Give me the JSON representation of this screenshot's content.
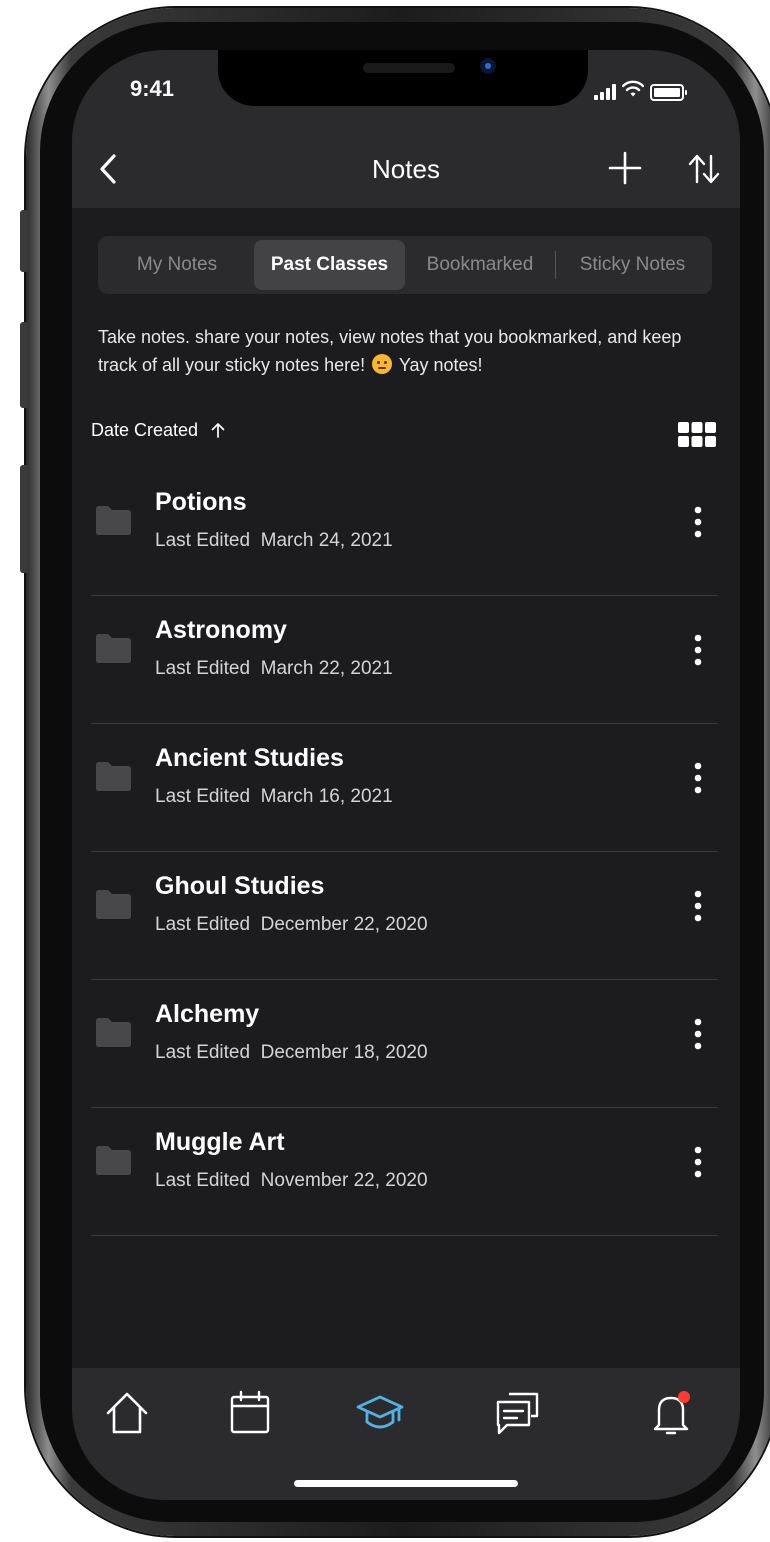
{
  "status_bar": {
    "time": "9:41"
  },
  "header": {
    "title": "Notes",
    "back_icon": "chevron-left-icon",
    "add_icon": "plus-icon",
    "sort_icon": "sort-arrows-icon"
  },
  "tabs": [
    {
      "label": "My Notes",
      "active": false
    },
    {
      "label": "Past Classes",
      "active": true
    },
    {
      "label": "Bookmarked",
      "active": false
    },
    {
      "label": "Sticky Notes",
      "active": false
    }
  ],
  "intro": {
    "text_before_emoji": "Take notes. share your notes, view notes that you bookmarked, and keep track of all your sticky notes here!",
    "text_after_emoji": "Yay notes!"
  },
  "sort": {
    "label": "Date Created",
    "direction": "ascending"
  },
  "items": [
    {
      "title": "Potions",
      "edited_label": "Last Edited",
      "date": "March 24, 2021"
    },
    {
      "title": "Astronomy",
      "edited_label": "Last Edited",
      "date": "March 22, 2021"
    },
    {
      "title": "Ancient Studies",
      "edited_label": "Last Edited",
      "date": "March 16, 2021"
    },
    {
      "title": "Ghoul Studies",
      "edited_label": "Last Edited",
      "date": "December 22, 2020"
    },
    {
      "title": "Alchemy",
      "edited_label": "Last Edited",
      "date": "December 18, 2020"
    },
    {
      "title": "Muggle Art",
      "edited_label": "Last Edited",
      "date": "November 22, 2020"
    }
  ],
  "tab_bar": [
    {
      "icon": "home-icon",
      "active": false
    },
    {
      "icon": "calendar-icon",
      "active": false
    },
    {
      "icon": "graduation-cap-icon",
      "active": true
    },
    {
      "icon": "chat-icon",
      "active": false
    },
    {
      "icon": "bell-icon",
      "active": false,
      "badge": true
    }
  ],
  "colors": {
    "background": "#1c1c1e",
    "surface": "#2b2b2d",
    "active_tab": "#434346",
    "accent": "#4fb3e8",
    "badge": "#ff3b30",
    "text_secondary": "#8a8a8e"
  }
}
